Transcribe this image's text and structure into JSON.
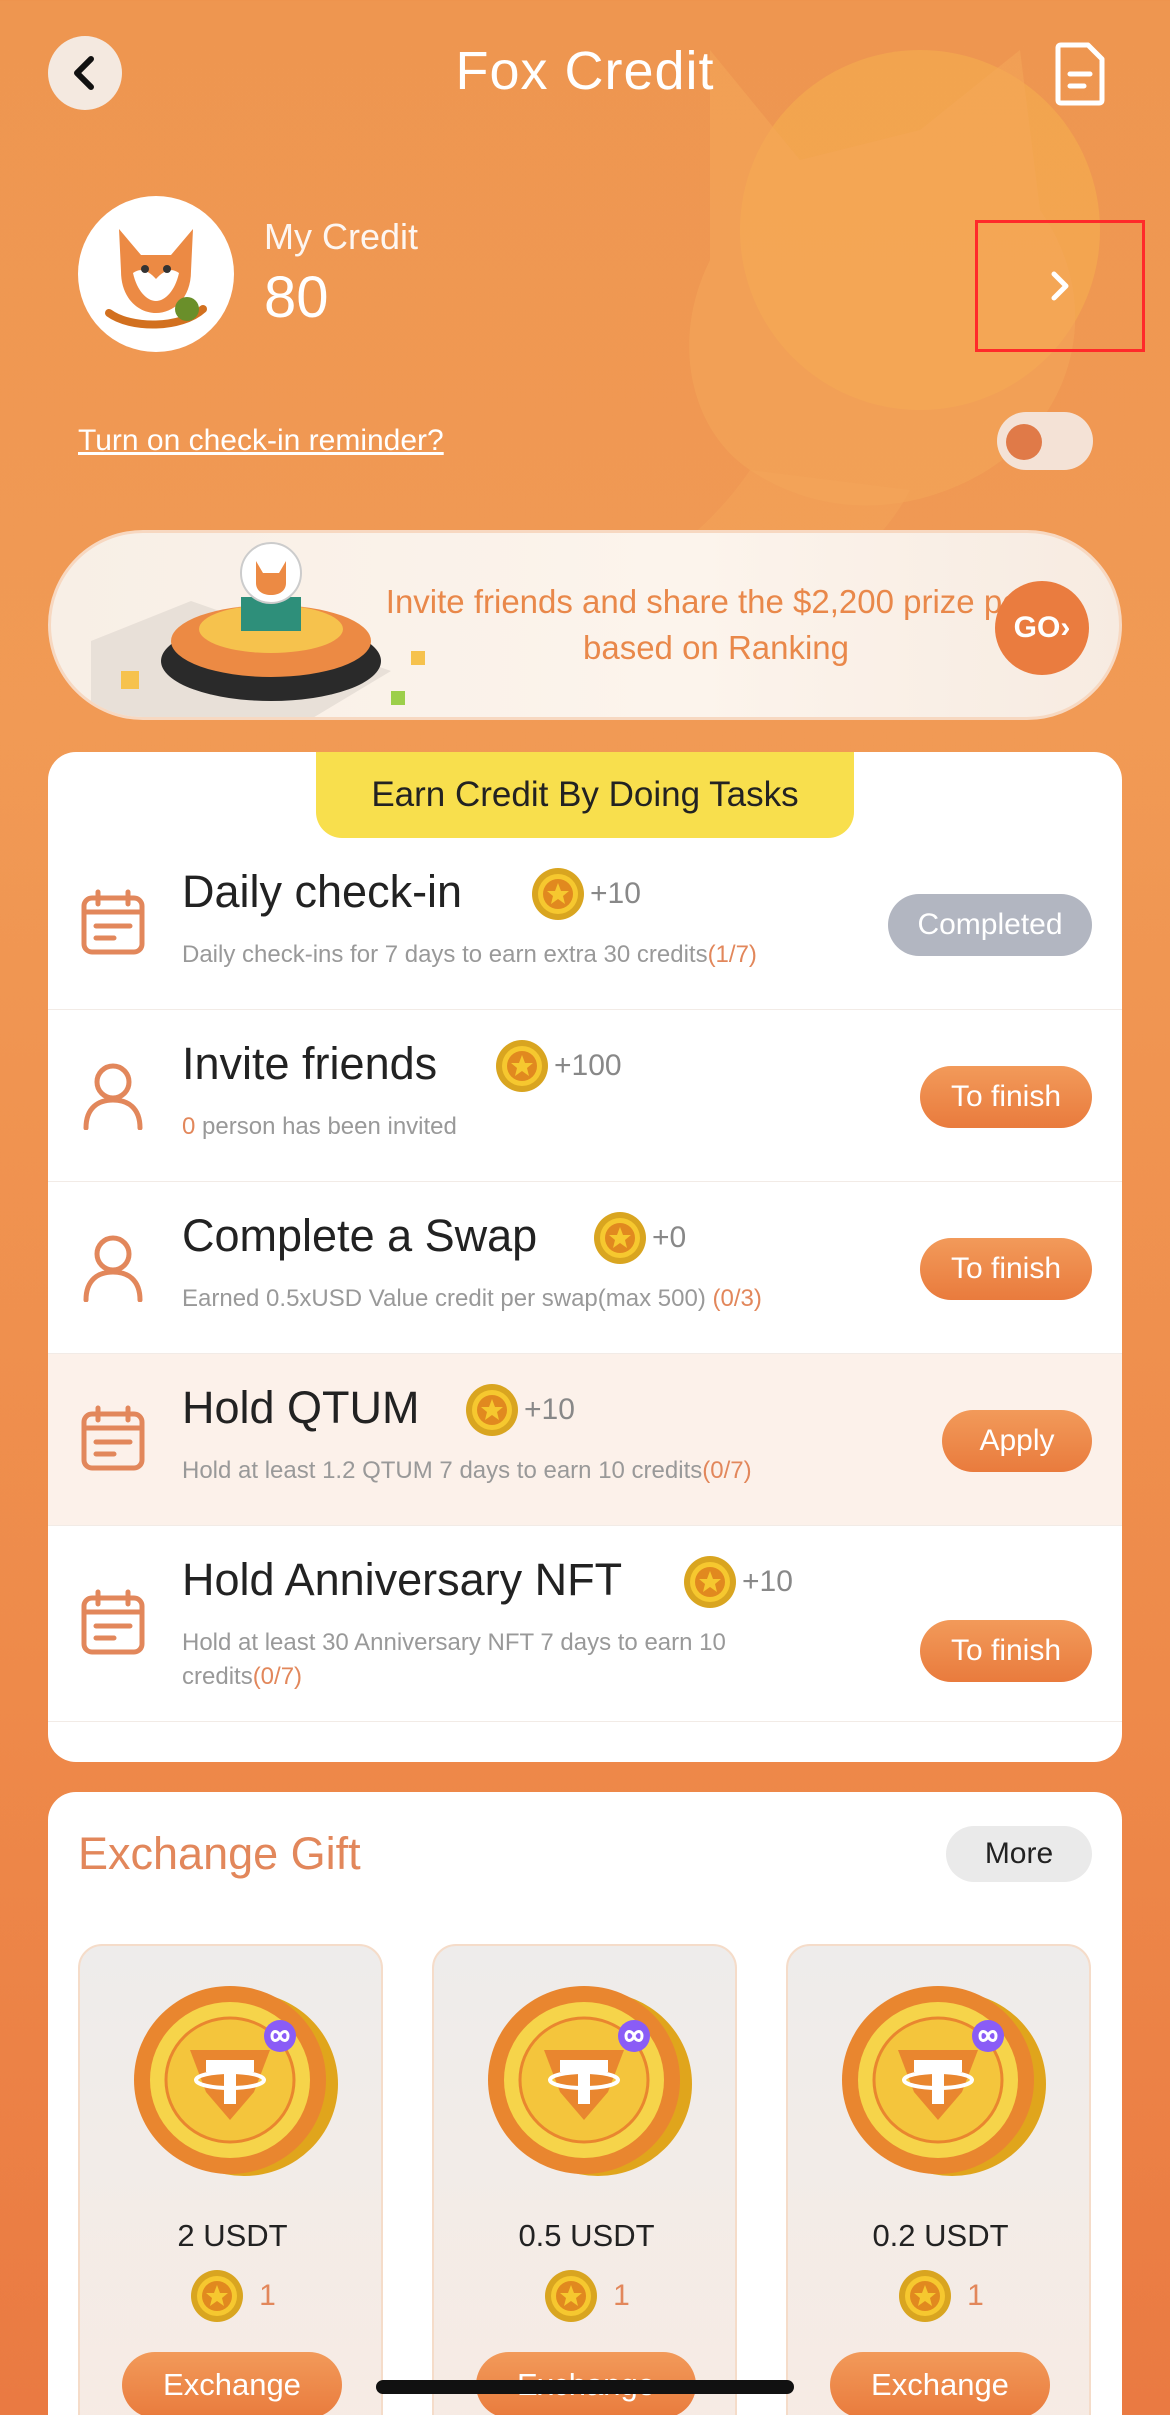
{
  "header": {
    "title": "Fox Credit"
  },
  "credit": {
    "label": "My Credit",
    "value": "80"
  },
  "reminder": {
    "label": "Turn on check-in reminder?",
    "enabled": false
  },
  "banner": {
    "text": "Invite friends and share the $2,200 prize pool based on Ranking",
    "go_label": "GO›"
  },
  "tasks": {
    "header": "Earn Credit By Doing Tasks",
    "items": [
      {
        "title": "Daily check-in",
        "reward": "+10",
        "desc": "Daily check-ins for 7 days to earn extra 30 credits",
        "progress": "(1/7)",
        "button": "Completed"
      },
      {
        "title": "Invite friends",
        "reward": "+100",
        "desc_prefix": "0",
        "desc": " person has been invited",
        "button": "To finish"
      },
      {
        "title": "Complete a Swap",
        "reward": "+0",
        "desc": "Earned 0.5xUSD Value credit per swap(max 500) ",
        "progress": " (0/3)",
        "button": "To finish"
      },
      {
        "title": "Hold QTUM",
        "reward": "+10",
        "desc": "Hold at least 1.2 QTUM 7 days to earn 10 credits",
        "progress": "(0/7)",
        "button": "Apply"
      },
      {
        "title": "Hold Anniversary NFT",
        "reward": "+10",
        "desc": "Hold at least 30 Anniversary NFT 7 days to earn 10 credits",
        "progress": "(0/7)",
        "button": "To finish"
      }
    ]
  },
  "exchange": {
    "title": "Exchange Gift",
    "more_label": "More",
    "gifts": [
      {
        "name": "2 USDT",
        "cost": "1",
        "button": "Exchange"
      },
      {
        "name": "0.5 USDT",
        "cost": "1",
        "button": "Exchange"
      },
      {
        "name": "0.2 USDT",
        "cost": "1",
        "button": "Exchange"
      }
    ]
  },
  "colors": {
    "accent": "#e97b3d",
    "highlight_row": "#fcf1ea",
    "tasks_header": "#f8df4d",
    "completed_btn": "#b2b6c1"
  }
}
